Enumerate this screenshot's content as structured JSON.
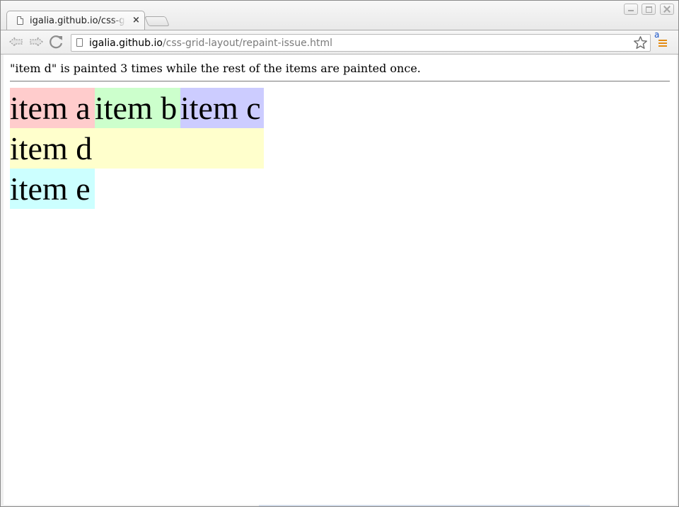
{
  "browser": {
    "tab_title": "igalia.github.io/css-grid-layout/repaint-issue.html",
    "tab_close": "×",
    "url_host": "igalia.github.io",
    "url_path": "/css-grid-layout/repaint-issue.html",
    "extension_letter": "a"
  },
  "icons": {
    "back": "back-arrow-icon",
    "forward": "forward-arrow-icon",
    "reload": "reload-icon",
    "page": "page-icon",
    "star": "star-icon",
    "extension": "extension-icon"
  },
  "page": {
    "description": "\"item d\" is painted 3 times while the rest of the items are painted once.",
    "items": [
      {
        "label": "item a",
        "color": "#ffcccc"
      },
      {
        "label": "item b",
        "color": "#ccffcc"
      },
      {
        "label": "item c",
        "color": "#ccccff"
      },
      {
        "label": "item d",
        "color": "#ffffcc"
      },
      {
        "label": "item e",
        "color": "#ccffff"
      }
    ]
  }
}
